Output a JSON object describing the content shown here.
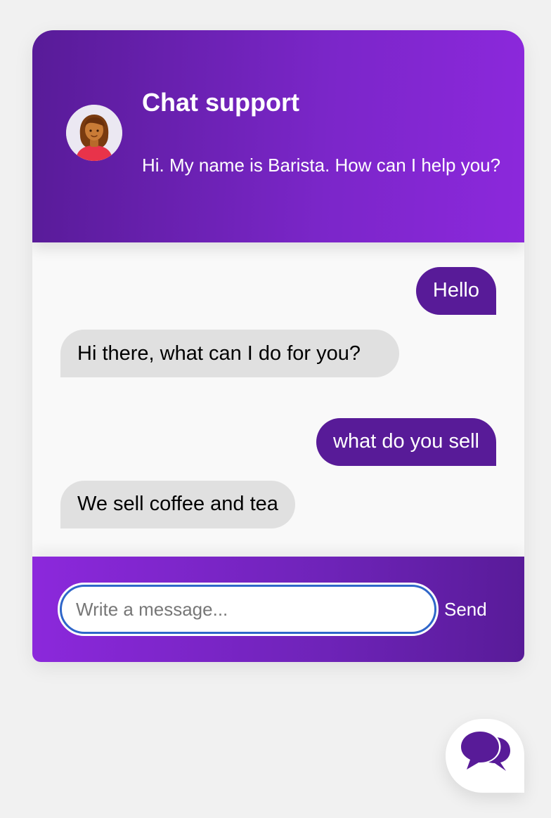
{
  "header": {
    "title": "Chat support",
    "subtitle": "Hi. My name is Barista. How can I help you?",
    "avatar_icon": "woman-avatar-icon"
  },
  "messages": [
    {
      "sender": "operator",
      "text": "Hello"
    },
    {
      "sender": "visitor",
      "text": "Hi there, what can I do for you?"
    },
    {
      "sender": "operator",
      "text": "what do you sell"
    },
    {
      "sender": "visitor",
      "text": "We sell coffee and tea"
    }
  ],
  "footer": {
    "input_placeholder": "Write a message...",
    "input_value": "",
    "send_label": "Send"
  },
  "launcher": {
    "icon": "chat-bubbles-icon"
  },
  "colors": {
    "primary": "#581b98",
    "accent": "#8c28dc",
    "visitor_bubble": "#e0e0e0",
    "page_background": "#f1f1f1",
    "input_focus": "#2f66c9"
  }
}
